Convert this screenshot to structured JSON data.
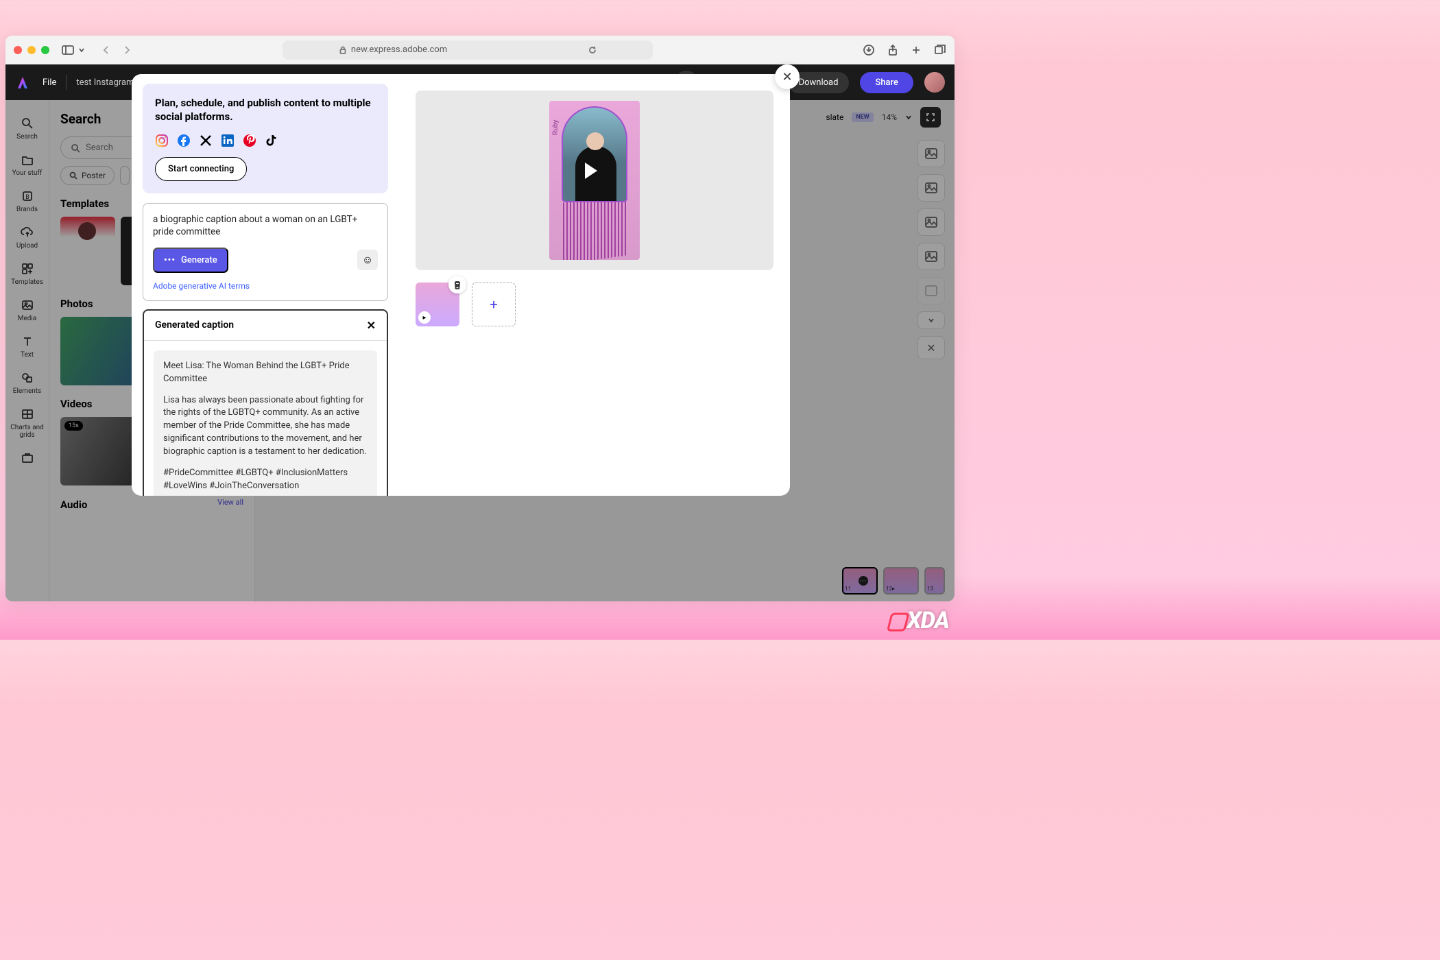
{
  "browser": {
    "url": "new.express.adobe.com"
  },
  "appbar": {
    "file": "File",
    "doc_title": "test Instagram story",
    "download": "Download",
    "share": "Share"
  },
  "toprow": {
    "translate": "slate",
    "new_badge": "NEW",
    "zoom": "14%"
  },
  "leftrail": {
    "search": "Search",
    "yourstuff": "Your stuff",
    "brands": "Brands",
    "upload": "Upload",
    "templates": "Templates",
    "media": "Media",
    "text": "Text",
    "elements": "Elements",
    "charts": "Charts and grids"
  },
  "leftpanel": {
    "title": "Search",
    "search_placeholder": "Search",
    "chip_poster": "Poster",
    "sect_templates": "Templates",
    "sect_photos": "Photos",
    "sect_videos": "Videos",
    "sect_audio": "Audio",
    "view_all": "View all"
  },
  "modal": {
    "connect_heading": "Plan, schedule, and publish content to multiple social platforms.",
    "start_connecting": "Start connecting",
    "prompt_text": "a biographic caption about a woman on an LGBT+ pride committee",
    "generate": "Generate",
    "ai_terms": "Adobe generative AI terms",
    "gen_caption_title": "Generated caption",
    "caption_p1": "Meet Lisa: The Woman Behind the LGBT+ Pride Committee",
    "caption_p2": "Lisa has always been passionate about fighting for the rights of the LGBTQ+ community. As an active member of the Pride Committee, she has made significant contributions to the movement, and her biographic caption is a testament to her dedication.",
    "caption_p3": "#PrideCommittee #LGBTQ+ #InclusionMatters #LoveWins #JoinTheConversation",
    "ruby": "Ruby"
  },
  "pagestrip": {
    "p11": "11",
    "p12": "12",
    "p13": "13"
  },
  "watermark": "XDA"
}
